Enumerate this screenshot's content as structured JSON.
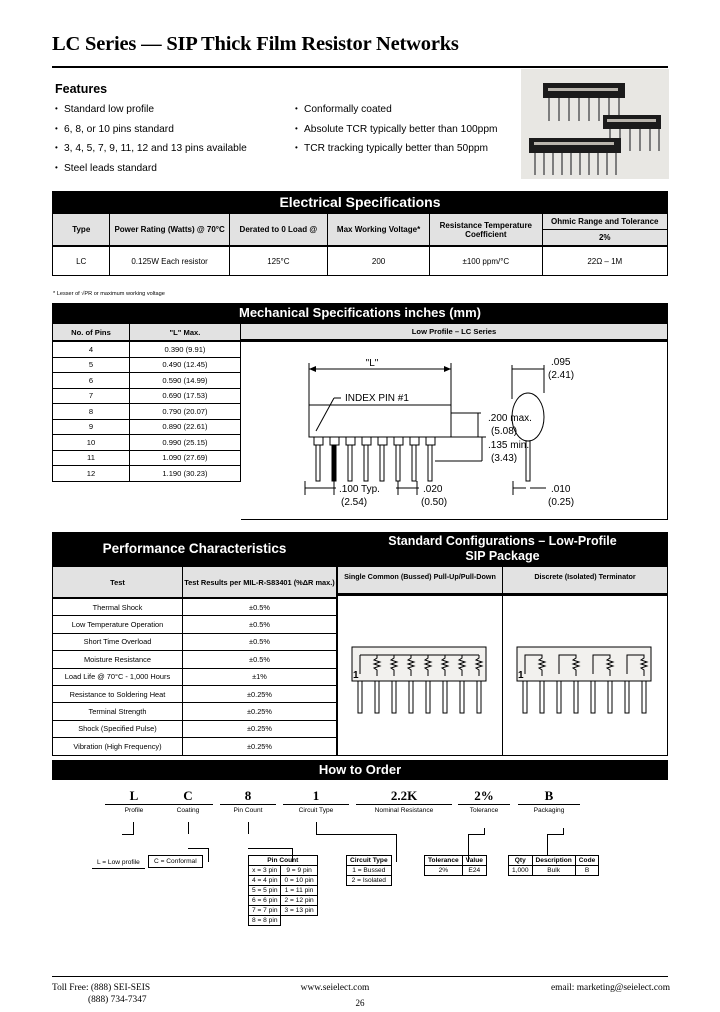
{
  "document": {
    "title": "LC Series — SIP Thick Film Resistor Networks",
    "page_number": "26"
  },
  "features": {
    "heading": "Features",
    "left": [
      "Standard low profile",
      "6, 8, or 10 pins standard",
      "3, 4, 5, 7, 9, 11, 12 and 13 pins available",
      "Steel leads standard"
    ],
    "right": [
      "Conformally coated",
      "Absolute TCR typically better than 100ppm",
      "TCR tracking typically better than 50ppm"
    ]
  },
  "photo": {
    "caption": "sip-resistor-network-photo"
  },
  "electrical": {
    "band": "Electrical Specifications",
    "headers": {
      "type": "Type",
      "power_rating": "Power Rating\n(Watts) @ 70°C",
      "power_rating_l1": "Power Rating",
      "power_rating_l2": "(Watts) @ 70°C",
      "derated_l1": "Derated to",
      "derated_l2": "0 Load @",
      "maxv_l1": "Max Working",
      "maxv_l2": "Voltage*",
      "tcr_l1": "Resistance",
      "tcr_l2": "Temperature Coefficient",
      "ohmic": "Ohmic Range and Tolerance",
      "ohmic_sub": "2%"
    },
    "row": {
      "type": "LC",
      "power_l1": "0.125W",
      "power_l2": "Each resistor",
      "derated": "125°C",
      "max_voltage": "200",
      "tcr": "±100 ppm/°C",
      "ohmic_range": "22Ω – 1M"
    },
    "footnote": "* Lesser of √PR or maximum working voltage"
  },
  "mechanical": {
    "band": "Mechanical Specifications inches (mm)",
    "col_pins": "No. of Pins",
    "col_len": "\"L\" Max.",
    "subheader": "Low Profile – LC Series",
    "rows": [
      {
        "pins": "4",
        "l": "0.390 (9.91)"
      },
      {
        "pins": "5",
        "l": "0.490 (12.45)"
      },
      {
        "pins": "6",
        "l": "0.590 (14.99)"
      },
      {
        "pins": "7",
        "l": "0.690 (17.53)"
      },
      {
        "pins": "8",
        "l": "0.790 (20.07)"
      },
      {
        "pins": "9",
        "l": "0.890 (22.61)"
      },
      {
        "pins": "10",
        "l": "0.990 (25.15)"
      },
      {
        "pins": "11",
        "l": "1.090 (27.69)"
      },
      {
        "pins": "12",
        "l": "1.190 (30.23)"
      }
    ],
    "drawing": {
      "length_label": "\"L\"",
      "index_pin": "INDEX PIN #1",
      "height_max_l1": ".200 max.",
      "height_max_l2": "(5.08)",
      "height_min_l1": ".135 min.",
      "height_min_l2": "(3.43)",
      "pitch_l1": ".100 Typ.",
      "pitch_l2": "(2.54)",
      "lead_w_l1": ".020",
      "lead_w_l2": "(0.50)",
      "thick_l1": ".095",
      "thick_l2": "(2.41)",
      "lead_t_l1": ".010",
      "lead_t_l2": "(0.25)"
    }
  },
  "performance": {
    "band": "Performance Characteristics",
    "col_test": "Test",
    "col_result": "Test Results per MIL-R-S83401 (%ΔR max.)",
    "rows": [
      {
        "test": "Thermal Shock",
        "result": "±0.5%"
      },
      {
        "test": "Low Temperature Operation",
        "result": "±0.5%"
      },
      {
        "test": "Short Time Overload",
        "result": "±0.5%"
      },
      {
        "test": "Moisture Resistance",
        "result": "±0.5%"
      },
      {
        "test": "Load Life @ 70°C - 1,000 Hours",
        "result": "±1%"
      },
      {
        "test": "Resistance to Soldering Heat",
        "result": "±0.25%"
      },
      {
        "test": "Terminal Strength",
        "result": "±0.25%"
      },
      {
        "test": "Shock (Specified Pulse)",
        "result": "±0.25%"
      },
      {
        "test": "Vibration (High Frequency)",
        "result": "±0.25%"
      }
    ]
  },
  "configurations": {
    "band_l1": "Standard Configurations – Low-Profile",
    "band_l2": "SIP Package",
    "col1_l1": "Single Common (Bussed)",
    "col1_l2": "Pull-Up/Pull-Down",
    "col2_l1": "Discrete (Isolated)",
    "col2_l2": "Terminator",
    "pin_one_label": "1"
  },
  "order": {
    "band": "How to Order",
    "items": [
      {
        "code": "L",
        "label": "Profile"
      },
      {
        "code": "C",
        "label": "Coating"
      },
      {
        "code": "8",
        "label": "Pin Count"
      },
      {
        "code": "1",
        "label": "Circuit Type"
      },
      {
        "code": "2.2K",
        "label": "Nominal Resistance"
      },
      {
        "code": "2%",
        "label": "Tolerance"
      },
      {
        "code": "B",
        "label": "Packaging"
      }
    ],
    "profile_note": "L = Low profile",
    "coating_note": "C = Conformal",
    "pin_count": {
      "title": "Pin Count",
      "left": [
        "x = 3 pin",
        "4 = 4 pin",
        "5 = 5 pin",
        "6 = 6 pin",
        "7 = 7 pin",
        "8 = 8 pin"
      ],
      "right": [
        "9 = 9 pin",
        "0 = 10 pin",
        "1 = 11 pin",
        "2 = 12 pin",
        "3 = 13 pin"
      ]
    },
    "circuit_type": {
      "title": "Circuit Type",
      "rows": [
        "1 = Bussed",
        "2 = Isolated"
      ]
    },
    "tolerance": {
      "h1": "Tolerance",
      "h2": "Value",
      "v1": "2%",
      "v2": "E24"
    },
    "packaging": {
      "h1": "Qty",
      "h2": "Description",
      "h3": "Code",
      "v1": "1,000",
      "v2": "Bulk",
      "v3": "B"
    }
  },
  "footer": {
    "toll_free_l1": "Toll Free: (888) SEI-SEIS",
    "toll_free_l2": "(888) 734-7347",
    "website": "www.seielect.com",
    "email": "email: marketing@seielect.com"
  }
}
